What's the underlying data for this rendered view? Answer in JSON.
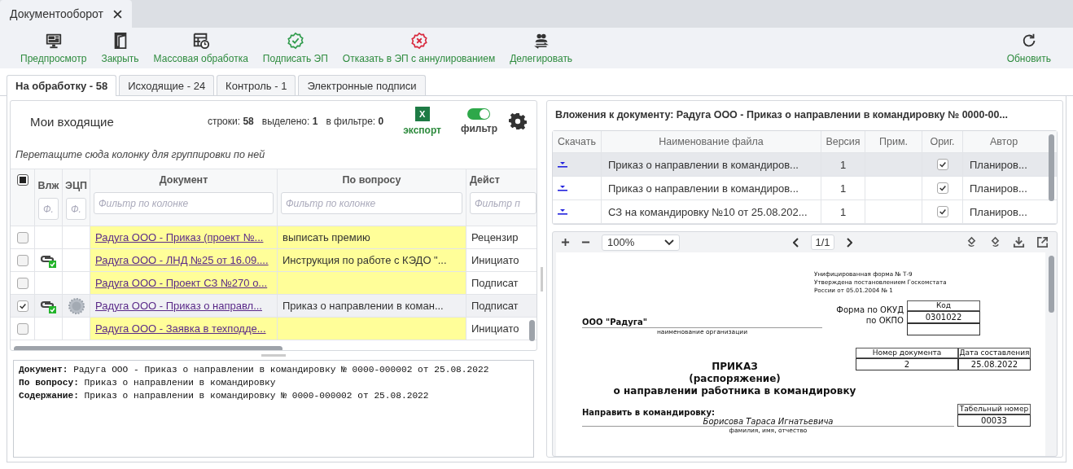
{
  "app_tab": {
    "title": "Документооборот",
    "selected": true
  },
  "toolbar": {
    "left": [
      {
        "kind": "preview",
        "label": "Предпросмотр"
      },
      {
        "kind": "close",
        "label": "Закрыть"
      },
      {
        "kind": "batch",
        "label": "Массовая обработка"
      },
      {
        "kind": "sign",
        "label": "Подписать ЭП"
      },
      {
        "kind": "reject",
        "label": "Отказать в ЭП с аннулированием"
      },
      {
        "kind": "delegate",
        "label": "Делегировать"
      }
    ],
    "right": [
      {
        "kind": "refresh",
        "label": "Обновить"
      }
    ]
  },
  "tabs": [
    {
      "label": "На обработку - 58",
      "selected": true
    },
    {
      "label": "Исходящие - 24",
      "selected": false
    },
    {
      "label": "Контроль - 1",
      "selected": false
    },
    {
      "label": "Электронные подписи",
      "selected": false
    }
  ],
  "inbox": {
    "title": "Мои входящие",
    "stats": [
      {
        "label": "строки:",
        "value": "58"
      },
      {
        "label": "выделено:",
        "value": "1"
      },
      {
        "label": "в фильтре:",
        "value": "0"
      }
    ],
    "export": {
      "badge": "X",
      "label": "экспорт"
    },
    "filter": {
      "label": "фильтр",
      "on": true
    },
    "group_hint": "Перетащите сюда колонку для группировки по ней",
    "select_all": {
      "indeterminate": true
    },
    "columns": [
      {
        "label": "Влж",
        "placeholder": "Ф."
      },
      {
        "label": "ЭЦП",
        "placeholder": "Ф."
      },
      {
        "label": "Документ",
        "placeholder": "Фильтр по колонке"
      },
      {
        "label": "По вопросу",
        "placeholder": "Фильтр по колонке"
      },
      {
        "label": "Дейст",
        "placeholder": "Фильтр п"
      }
    ],
    "rows": [
      {
        "checked": false,
        "selected": false,
        "highlighted": true,
        "attachment": false,
        "signature": false,
        "document": "Радуга ООО - Приказ (проект №...",
        "subject": "выписать премию",
        "action": "Рецензир"
      },
      {
        "checked": false,
        "selected": false,
        "highlighted": true,
        "attachment": true,
        "signature": false,
        "document": "Радуга ООО - ЛНД №25 от 16.09....",
        "subject": "Инструкция по работе с КЭДО \"...",
        "action": "Инициато"
      },
      {
        "checked": false,
        "selected": false,
        "highlighted": true,
        "attachment": false,
        "signature": false,
        "document": "Радуга ООО - Проект СЗ №270 о...",
        "action": "Подписат"
      },
      {
        "checked": true,
        "selected": true,
        "highlighted": false,
        "attachment": true,
        "signature": true,
        "document": "Радуга ООО - Приказ о направл...",
        "subject": "Приказ о направлении в коман...",
        "action": "Подписат"
      },
      {
        "checked": false,
        "selected": false,
        "highlighted": true,
        "attachment": false,
        "signature": false,
        "document": "Радуга ООО - Заявка в техподде...",
        "action": "Инициато"
      }
    ]
  },
  "details": [
    {
      "label": "Документ:",
      "value": "Радуга ООО - Приказ о направлении в командировку № 0000-000002 от 25.08.2022"
    },
    {
      "label": "По вопросу:",
      "value": "Приказ о направлении в командировку"
    },
    {
      "label": "Содержание:",
      "value": "Приказ о направлении в командировку № 0000-000002 от 25.08.2022"
    }
  ],
  "attachments": {
    "title": "Вложения к документу: Радуга ООО - Приказ о направлении в командировку № 0000-00...",
    "columns": [
      "Скачать",
      "Наименование файла",
      "Версия",
      "Прим.",
      "Ориг.",
      "Автор"
    ],
    "rows": [
      {
        "selected": true,
        "name": "Приказ о направлении в командиров...",
        "version": "1",
        "original": true,
        "author": "Планиров..."
      },
      {
        "selected": false,
        "name": "Приказ о направлении в командиров...",
        "version": "1",
        "original": true,
        "author": "Планиров..."
      },
      {
        "selected": false,
        "name": "СЗ на командировку №10 от 25.08.202...",
        "version": "1",
        "original": true,
        "author": "Планиров..."
      }
    ]
  },
  "viewer": {
    "zoom": "100%",
    "page": "1/1"
  },
  "document": {
    "form_header": [
      "Унифицированная форма № Т-9",
      "Утверждена постановлением Госкомстата",
      "России от 05.01.2004 № 1"
    ],
    "code_label": "Код",
    "okud_label": "Форма по ОКУД",
    "okud": "0301022",
    "okpo_label": "по ОКПО",
    "organization": "ООО \"Радуга\"",
    "organization_caption": "наименование организации",
    "number_label": "Номер документа",
    "date_label": "Дата составления",
    "number": "2",
    "date": "25.08.2022",
    "title": "ПРИКАЗ",
    "subtitle": "(распоряжение)",
    "subject": "о направлении работника в командировку",
    "send_label": "Направить в командировку:",
    "employee": "Борисова Тараса Игнатьевича",
    "employee_caption": "фамилия, имя, отчество",
    "tab_number_label": "Табельный номер",
    "tab_number": "00033"
  }
}
